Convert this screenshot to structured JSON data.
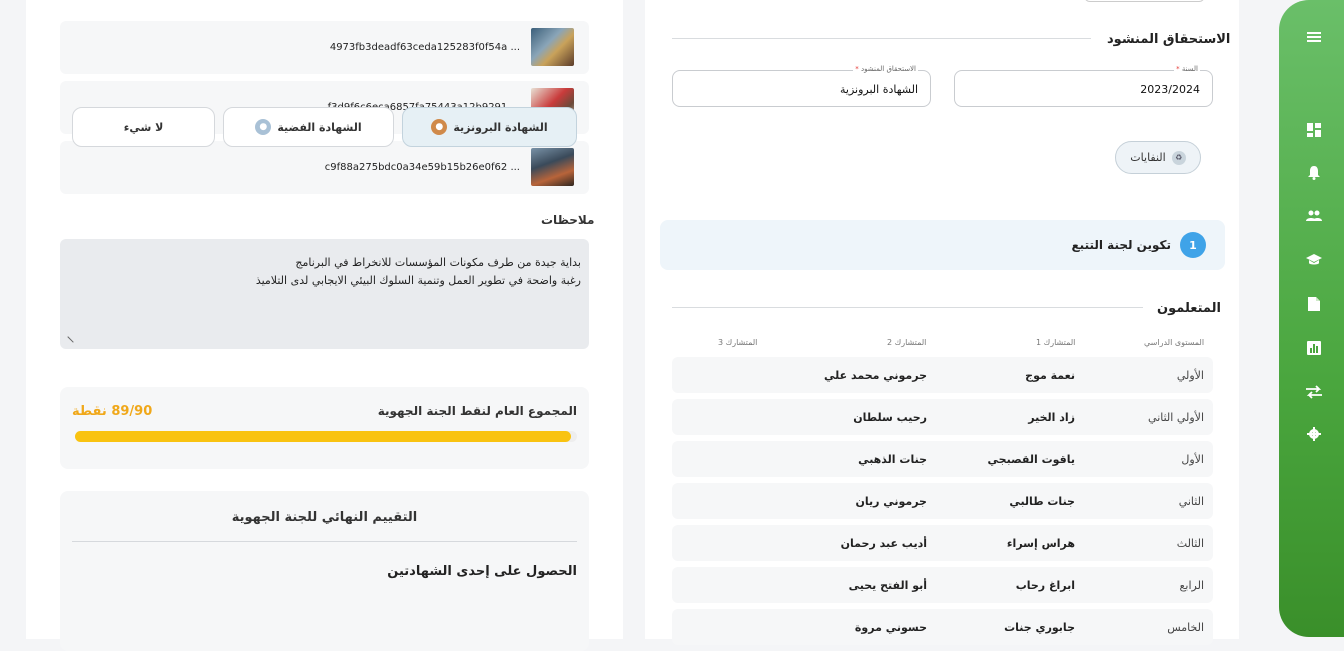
{
  "files": [
    {
      "name": "4973fb3deadf63ceda125283f0f54a ..."
    },
    {
      "name": "f3d9f6c6eca6857fa75443a12b9291 ..."
    },
    {
      "name": "c9f88a275bdc0a34e59b15b26e0f62 ..."
    }
  ],
  "notes": {
    "label": "ملاحظات",
    "line1": "بداية جيدة من طرف مكونات المؤسسات للانخراط في البرنامج",
    "line2": "رغبة واضحة في تطوير العمل وتنمية السلوك البيئي الايجابي لدى التلاميذ"
  },
  "score": {
    "title": "المجموع العام لنقط الجنة الجهوية",
    "value": "89/90 نقطة",
    "progress": 0.989
  },
  "final": {
    "title": "التقييم النهائي للجنة الجهوية",
    "cert_title": "الحصول على إحدى الشهادتين",
    "options": [
      "الشهادة البرونزية",
      "الشهادة الفضية",
      "لا شيء"
    ],
    "selected": "الشهادة البرونزية"
  },
  "claim": {
    "title": "الاستحقاق المنشود",
    "year_label": "السنة",
    "year_value": "2023/2024",
    "target_label": "الاستحقاق المنشود",
    "target_value": "الشهادة البرونزية",
    "chip": "النفايات"
  },
  "step": {
    "number": "1",
    "label": "تكوين لجنة التتبع"
  },
  "learners": {
    "title": "المتعلمون",
    "headers": [
      "المستوى الدراسي",
      "المتشارك 1",
      "المتشارك 2",
      "المتشارك 3"
    ],
    "rows": [
      {
        "level": "الأولي",
        "p1": "نعمة موج",
        "p2": "جرموني محمد علي"
      },
      {
        "level": "الأولي الثاني",
        "p1": "زاد الخير",
        "p2": "رحيب سلطان"
      },
      {
        "level": "الأول",
        "p1": "ياقوت القصبجي",
        "p2": "جنات الذهبي"
      },
      {
        "level": "الثاني",
        "p1": "جنات طالبي",
        "p2": "جرموني ريان"
      },
      {
        "level": "الثالث",
        "p1": "هراس إسراء",
        "p2": "أديب عبد رحمان"
      },
      {
        "level": "الرابع",
        "p1": "ابراغ رحاب",
        "p2": "أبو الفتح يحيى"
      },
      {
        "level": "الخامس",
        "p1": "جابوري جنات",
        "p2": "حسوني مروة"
      }
    ]
  },
  "colors": {
    "sidebar_green": "#4aa63e",
    "accent_yellow": "#f9c311",
    "score_orange": "#f0a81a",
    "step_blue": "#3fa3e8"
  }
}
